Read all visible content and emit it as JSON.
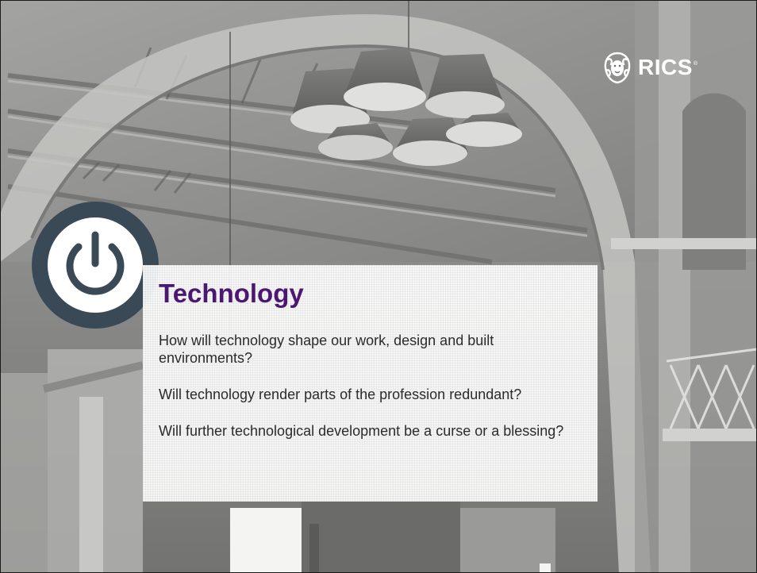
{
  "logo": {
    "icon": "lion-icon",
    "text": "RICS",
    "registered_mark": "®"
  },
  "badge": {
    "icon": "power-icon"
  },
  "slide": {
    "title": "Technology",
    "questions": [
      "How will technology shape our work, design and built environments?",
      "Will technology render parts of the profession redundant?",
      "Will further technological development be a curse or a blessing?"
    ]
  },
  "colors": {
    "title": "#4b1770",
    "body_text": "#2b2b2b",
    "badge_ring": "#394955",
    "logo_text": "#ffffff"
  }
}
